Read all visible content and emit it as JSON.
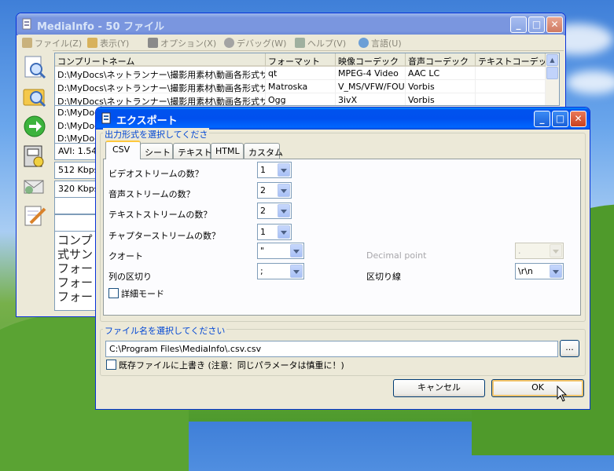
{
  "main_window": {
    "title": "MediaInfo - 50 ファイル",
    "menu": [
      {
        "label": "ファイル(Z)",
        "icon": "wrench-icon"
      },
      {
        "label": "表示(Y)",
        "icon": "view-icon"
      },
      {
        "label": "オプション(X)",
        "icon": "options-icon"
      },
      {
        "label": "デバッグ(W)",
        "icon": "debug-gear-icon"
      },
      {
        "label": "ヘルプ(V)",
        "icon": "help-icon"
      },
      {
        "label": "言語(U)",
        "icon": "globe-icon"
      }
    ],
    "columns": [
      "コンプリートネーム",
      "フォーマット",
      "映像コーデック",
      "音声コーデック",
      "テキストコーデック"
    ],
    "rows": [
      [
        "D:\\MyDocs\\ネットランナー\\撮影用素材\\動画各形式サン",
        "qt",
        "MPEG-4 Video",
        "AAC LC",
        ""
      ],
      [
        "D:\\MyDocs\\ネットランナー\\撮影用素材\\動画各形式サン",
        "Matroska",
        "V_MS/VFW/FOU",
        "Vorbis",
        ""
      ],
      [
        "D:\\MyDocs\\ネットランナー\\撮影用素材\\動画各形式サン",
        "Ogg",
        "3ivX",
        "Vorbis",
        ""
      ],
      [
        "D:\\MyDocs",
        "",
        "",
        "",
        ""
      ],
      [
        "D:\\MyDocs",
        "",
        "",
        "",
        ""
      ],
      [
        "D:\\MyDocs",
        "",
        "",
        "",
        ""
      ]
    ],
    "info_row_1": "AVI: 1.54",
    "info_row_2": "512 Kbps",
    "info_row_3": "320 Kbps",
    "details_lines": [
      "コンプ",
      "式サン",
      "フォー",
      "フォー",
      "フォー"
    ]
  },
  "dialog": {
    "title": "エクスポート",
    "format_group_label": "出力形式を選択してくださ",
    "tabs": [
      "CSV",
      "シート",
      "テキスト",
      "HTML",
      "カスタム"
    ],
    "active_tab": "CSV",
    "fields": {
      "video_count_label": "ビデオストリームの数？",
      "video_count_value": "1",
      "audio_count_label": "音声ストリームの数？",
      "audio_count_value": "2",
      "text_count_label": "テキストストリームの数？",
      "text_count_value": "2",
      "chapter_count_label": "チャプターストリームの数？",
      "chapter_count_value": "1",
      "quote_label": "クオート",
      "quote_value": "\"",
      "separator_label": "列の区切り",
      "separator_value": ";",
      "decimal_label": "Decimal point",
      "decimal_value": ".",
      "line_sep_label": "区切り線",
      "line_sep_value": "\\r\\n",
      "detail_mode_label": "詳細モード"
    },
    "file_group_label": "ファイル名を選択してください",
    "file_path": "C:\\Program Files\\MediaInfo\\.csv.csv",
    "browse_label": "...",
    "overwrite_label": "既存ファイルに上書き (注意：同じパラメータは慎重に！)",
    "cancel_label": "キャンセル",
    "ok_label": "OK"
  }
}
